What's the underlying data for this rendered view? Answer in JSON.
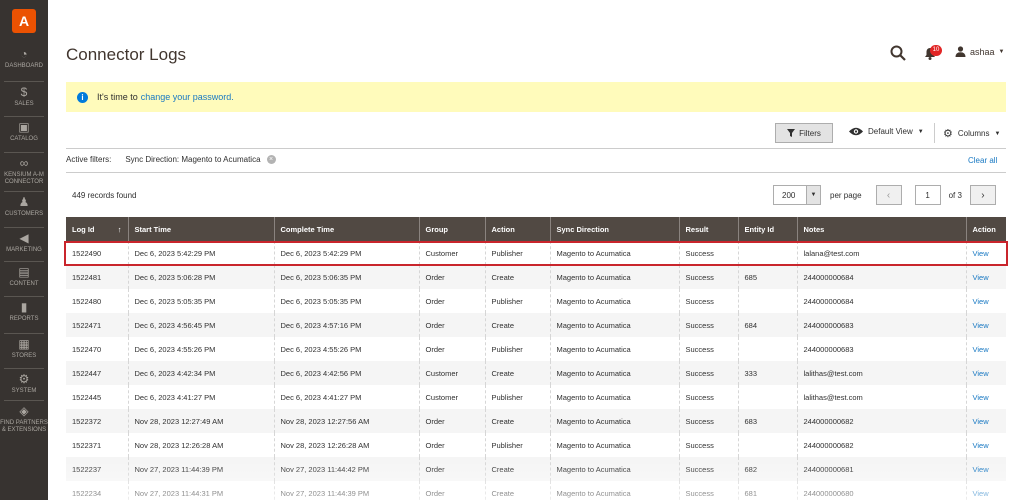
{
  "sidebar": {
    "logo": "A",
    "items": [
      {
        "label": "DASHBOARD",
        "icon": "dashboard-icon",
        "glyph": "◔"
      },
      {
        "label": "SALES",
        "icon": "dollar-icon",
        "glyph": "$"
      },
      {
        "label": "CATALOG",
        "icon": "catalog-box-icon",
        "glyph": "▣"
      },
      {
        "label": "KENSIUM A-M CONNECTOR",
        "icon": "connector-icon",
        "glyph": "∞"
      },
      {
        "label": "CUSTOMERS",
        "icon": "customer-icon",
        "glyph": "♟"
      },
      {
        "label": "MARKETING",
        "icon": "megaphone-icon",
        "glyph": "◀"
      },
      {
        "label": "CONTENT",
        "icon": "content-icon",
        "glyph": "▤"
      },
      {
        "label": "REPORTS",
        "icon": "reports-icon",
        "glyph": "▮"
      },
      {
        "label": "STORES",
        "icon": "store-icon",
        "glyph": "▦"
      },
      {
        "label": "SYSTEM",
        "icon": "gear-icon",
        "glyph": "⚙"
      },
      {
        "label": "FIND PARTNERS & EXTENSIONS",
        "icon": "extensions-icon",
        "glyph": "◈"
      }
    ]
  },
  "header": {
    "title": "Connector Logs",
    "notification_count": "10",
    "username": "ashaa"
  },
  "notice": {
    "text": "It's time to",
    "link": "change your password."
  },
  "toolbar": {
    "filters_label": "Filters",
    "view_label": "Default View",
    "columns_label": "Columns"
  },
  "active_filters": {
    "label": "Active filters:",
    "chip": "Sync Direction: Magento to Acumatica",
    "clear_all": "Clear all"
  },
  "records": "449 records found",
  "pager": {
    "per_page_value": "200",
    "per_page_label": "per page",
    "current_page": "1",
    "of_label": "of 3"
  },
  "table": {
    "headers": [
      "Log Id",
      "Start Time",
      "Complete Time",
      "Group",
      "Action",
      "Sync Direction",
      "Result",
      "Entity Id",
      "Notes",
      "Action"
    ],
    "rows": [
      [
        "1522490",
        "Dec 6, 2023 5:42:29 PM",
        "Dec 6, 2023 5:42:29 PM",
        "Customer",
        "Publisher",
        "Magento to Acumatica",
        "Success",
        "",
        "lalana@test.com",
        "View"
      ],
      [
        "1522481",
        "Dec 6, 2023 5:06:28 PM",
        "Dec 6, 2023 5:06:35 PM",
        "Order",
        "Create",
        "Magento to Acumatica",
        "Success",
        "685",
        "244000000684",
        "View"
      ],
      [
        "1522480",
        "Dec 6, 2023 5:05:35 PM",
        "Dec 6, 2023 5:05:35 PM",
        "Order",
        "Publisher",
        "Magento to Acumatica",
        "Success",
        "",
        "244000000684",
        "View"
      ],
      [
        "1522471",
        "Dec 6, 2023 4:56:45 PM",
        "Dec 6, 2023 4:57:16 PM",
        "Order",
        "Create",
        "Magento to Acumatica",
        "Success",
        "684",
        "244000000683",
        "View"
      ],
      [
        "1522470",
        "Dec 6, 2023 4:55:26 PM",
        "Dec 6, 2023 4:55:26 PM",
        "Order",
        "Publisher",
        "Magento to Acumatica",
        "Success",
        "",
        "244000000683",
        "View"
      ],
      [
        "1522447",
        "Dec 6, 2023 4:42:34 PM",
        "Dec 6, 2023 4:42:56 PM",
        "Customer",
        "Create",
        "Magento to Acumatica",
        "Success",
        "333",
        "lalithas@test.com",
        "View"
      ],
      [
        "1522445",
        "Dec 6, 2023 4:41:27 PM",
        "Dec 6, 2023 4:41:27 PM",
        "Customer",
        "Publisher",
        "Magento to Acumatica",
        "Success",
        "",
        "lalithas@test.com",
        "View"
      ],
      [
        "1522372",
        "Nov 28, 2023 12:27:49 AM",
        "Nov 28, 2023 12:27:56 AM",
        "Order",
        "Create",
        "Magento to Acumatica",
        "Success",
        "683",
        "244000000682",
        "View"
      ],
      [
        "1522371",
        "Nov 28, 2023 12:26:28 AM",
        "Nov 28, 2023 12:26:28 AM",
        "Order",
        "Publisher",
        "Magento to Acumatica",
        "Success",
        "",
        "244000000682",
        "View"
      ],
      [
        "1522237",
        "Nov 27, 2023 11:44:39 PM",
        "Nov 27, 2023 11:44:42 PM",
        "Order",
        "Create",
        "Magento to Acumatica",
        "Success",
        "682",
        "244000000681",
        "View"
      ],
      [
        "1522234",
        "Nov 27, 2023 11:44:31 PM",
        "Nov 27, 2023 11:44:39 PM",
        "Order",
        "Create",
        "Magento to Acumatica",
        "Success",
        "681",
        "244000000680",
        "View"
      ]
    ]
  }
}
